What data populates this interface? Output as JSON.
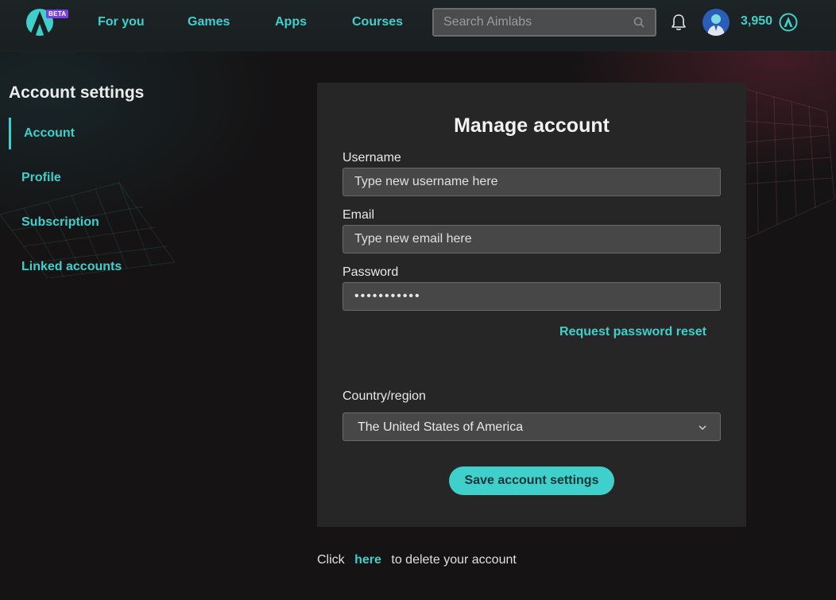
{
  "app": {
    "beta_badge": "BETA",
    "accent_color": "#3fd0cc"
  },
  "nav": {
    "items": [
      {
        "label": "For you"
      },
      {
        "label": "Games"
      },
      {
        "label": "Apps"
      },
      {
        "label": "Courses"
      }
    ],
    "search": {
      "placeholder": "Search Aimlabs",
      "icon": "search-icon"
    },
    "notifications_icon": "bell-icon",
    "points": "3,950",
    "points_icon": "aimlabs-token-icon"
  },
  "sidebar": {
    "title": "Account settings",
    "items": [
      {
        "label": "Account",
        "active": true
      },
      {
        "label": "Profile",
        "active": false
      },
      {
        "label": "Subscription",
        "active": false
      },
      {
        "label": "Linked accounts",
        "active": false
      }
    ]
  },
  "form": {
    "title": "Manage account",
    "username": {
      "label": "Username",
      "placeholder": "Type new username here",
      "value": ""
    },
    "email": {
      "label": "Email",
      "placeholder": "Type new email here",
      "value": ""
    },
    "password": {
      "label": "Password",
      "value": "•••••••••••"
    },
    "reset_link": "Request password reset",
    "country": {
      "label": "Country/region",
      "value": "The United States of America"
    },
    "save_label": "Save account settings"
  },
  "footer": {
    "prefix": "Click",
    "link": "here",
    "suffix": "to delete your account"
  }
}
